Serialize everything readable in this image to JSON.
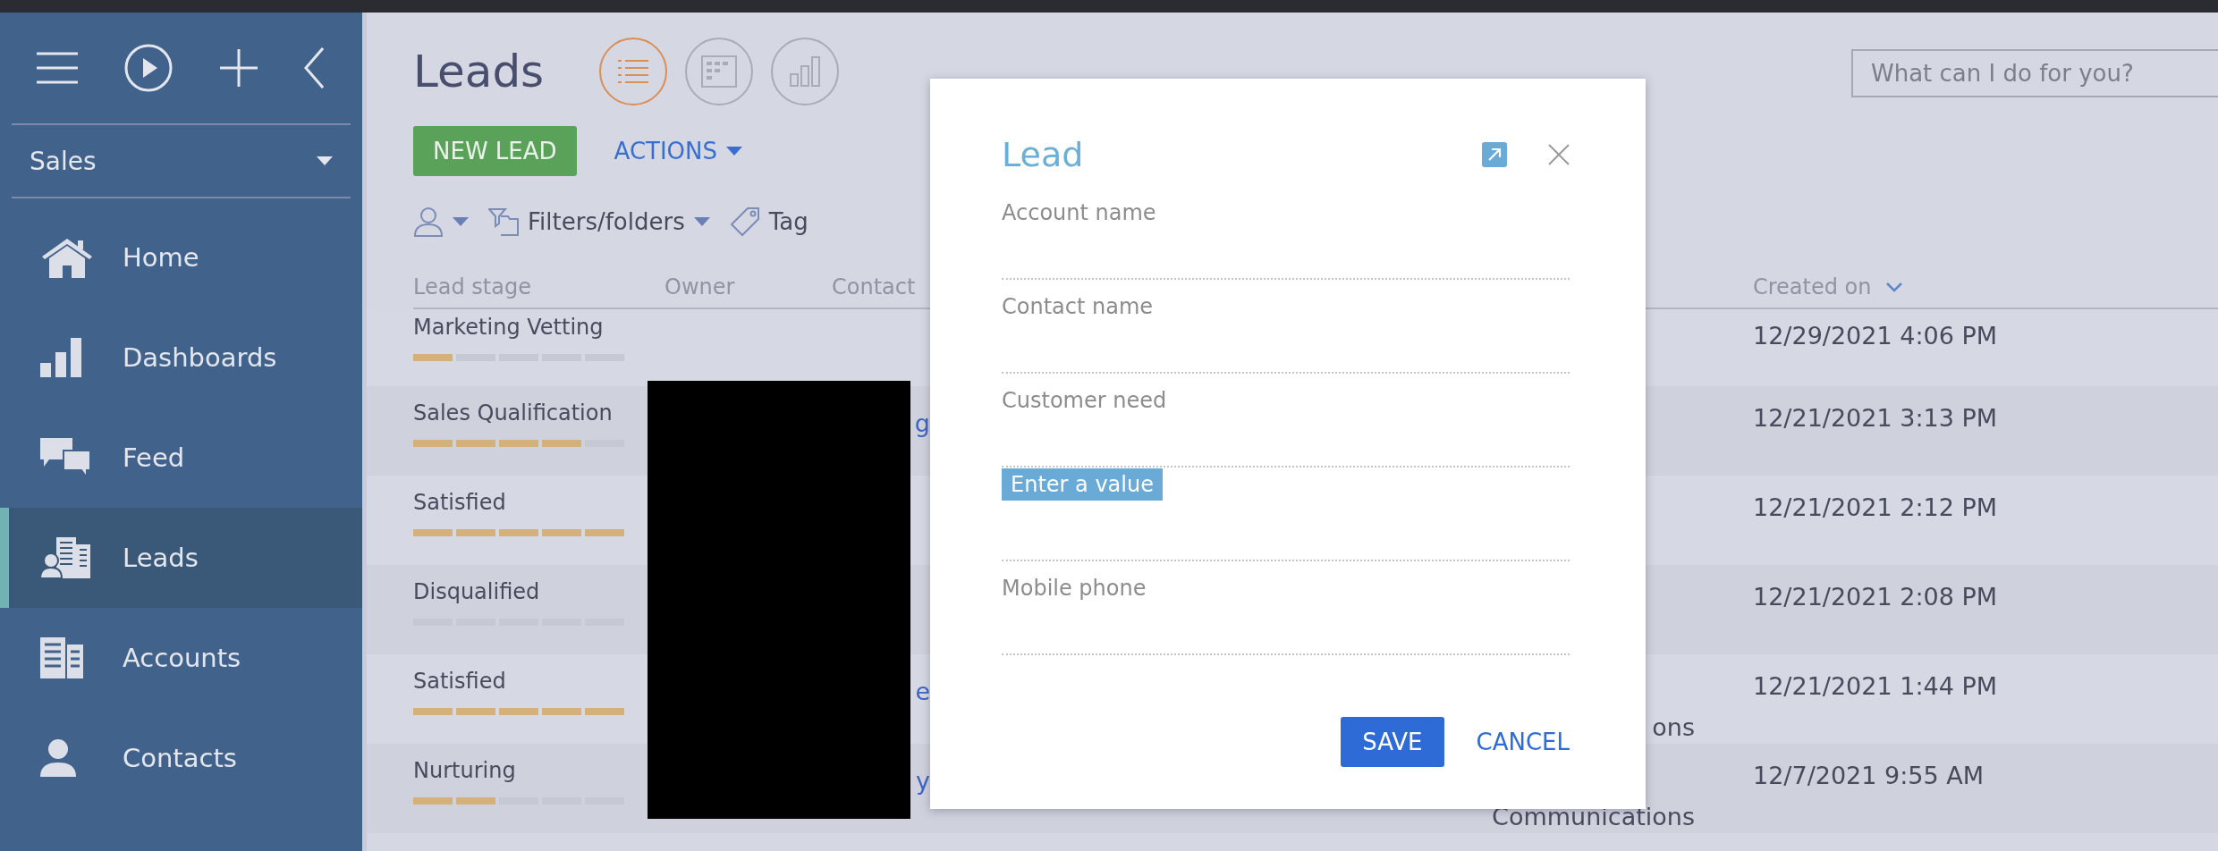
{
  "sidebar": {
    "tools": [
      {
        "kind": "menu"
      },
      {
        "kind": "play"
      },
      {
        "kind": "add"
      },
      {
        "kind": "collapse"
      }
    ],
    "workplace": {
      "label": "Sales"
    },
    "nav": [
      {
        "label": "Home",
        "selected": false
      },
      {
        "label": "Dashboards",
        "selected": false
      },
      {
        "label": "Feed",
        "selected": false
      },
      {
        "label": "Leads",
        "selected": true
      },
      {
        "label": "Accounts",
        "selected": false
      },
      {
        "label": "Contacts",
        "selected": false
      }
    ]
  },
  "page": {
    "title": "Leads",
    "views": [
      {
        "kind": "list",
        "selected": true
      },
      {
        "kind": "board",
        "selected": false
      },
      {
        "kind": "analytics",
        "selected": false
      }
    ],
    "new_button": "NEW LEAD",
    "actions_button": "ACTIONS",
    "filters": [
      {
        "kind": "owner"
      },
      {
        "kind": "folders",
        "label": "Filters/folders"
      },
      {
        "kind": "tag",
        "label": "Tag"
      }
    ]
  },
  "search": {
    "placeholder": "What can I do for you?"
  },
  "table": {
    "columns": [
      {
        "label": "Lead stage"
      },
      {
        "label": "Owner"
      },
      {
        "label": "Contact"
      },
      {
        "label": "Created on"
      }
    ],
    "redacted": true,
    "rows": [
      {
        "stage": "Marketing Vetting",
        "level": 0.2,
        "created_on": "12/29/2021 4:06 PM"
      },
      {
        "stage": "Sales Qualification",
        "level": 0.8,
        "contact": "g",
        "created_on": "12/21/2021 3:13 PM"
      },
      {
        "stage": "Satisfied",
        "level": 1,
        "created_on": "12/21/2021 2:12 PM"
      },
      {
        "stage": "Disqualified",
        "level": 0,
        "created_on": "12/21/2021 2:08 PM"
      },
      {
        "stage": "Satisfied",
        "level": 1,
        "contact": "e",
        "column_5": "ons",
        "created_on": "12/21/2021 1:44 PM"
      },
      {
        "stage": "Nurturing",
        "level": 0.4,
        "contact": "y",
        "column_5": "Communications",
        "created_on": "12/7/2021 9:55 AM"
      }
    ]
  },
  "dialog": {
    "title": "Lead",
    "fields": [
      {
        "kind": "input",
        "label": "Account name"
      },
      {
        "kind": "input",
        "label": "Contact name"
      },
      {
        "kind": "input",
        "label": "Customer need",
        "error": "Enter a value"
      },
      {
        "kind": "input"
      },
      {
        "kind": "input",
        "label": "Mobile phone"
      }
    ],
    "buttons": [
      {
        "kind": "primary",
        "label": "SAVE"
      },
      {
        "kind": "link",
        "label": "CANCEL"
      }
    ]
  }
}
